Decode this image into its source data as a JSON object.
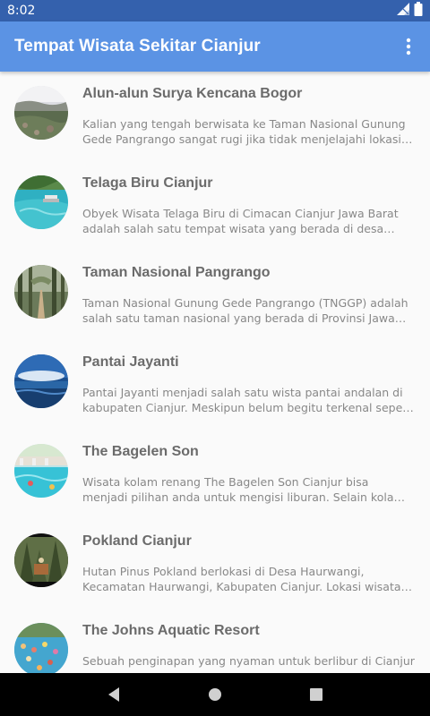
{
  "status_bar": {
    "time": "8:02",
    "icons": [
      "signal-icon",
      "battery-icon"
    ]
  },
  "app_bar": {
    "title": "Tempat Wisata Sekitar Cianjur",
    "menu_icon": "more-vert-icon"
  },
  "colors": {
    "status_bar": "#3461ad",
    "app_bar": "#5b93e4",
    "background": "#fafafa",
    "title_text": "#6b6b6b",
    "desc_text": "#888888",
    "nav_bar": "#000000"
  },
  "items": [
    {
      "title": "Alun-alun Surya Kencana Bogor",
      "description": "Kalian yang tengah berwisata ke Taman Nasional Gunung Gede Pangrango sangat rugi jika tidak menjelajahi lokasi wisata Alun-alun Surya Kencana",
      "image": "mountain-meadow-photo"
    },
    {
      "title": "Telaga Biru Cianjur",
      "description": "Obyek Wisata Telaga Biru di Cimacan  Cianjur Jawa Barat adalah salah satu tempat wisata yang berada di desa cimacan",
      "image": "blue-lake-photo"
    },
    {
      "title": "Taman Nasional Pangrango",
      "description": "Taman Nasional Gunung Gede Pangrango (TNGGP) adalah salah satu taman nasional yang berada di Provinsi Jawa Barat",
      "image": "forest-path-photo"
    },
    {
      "title": "Pantai Jayanti",
      "description": "Pantai Jayanti menjadi salah satu wista pantai andalan di kabupaten Cianjur. Meskipun belum begitu terkenal seperti pantai lain",
      "image": "beach-sky-photo"
    },
    {
      "title": "The Bagelen Son",
      "description": "Wisata kolam renang The Bagelen Son Cianjur bisa menjadi pilihan anda untuk mengisi liburan. Selain kolam renang",
      "image": "swimming-pool-photo"
    },
    {
      "title": "Pokland Cianjur",
      "description": "Hutan Pinus Pokland berlokasi di Desa Haurwangi, Kecamatan Haurwangi, Kabupaten Cianjur. Lokasi wisata ini",
      "image": "pine-forest-photo"
    },
    {
      "title": "The Johns Aquatic Resort",
      "description": "Sebuah penginapan yang nyaman untuk berlibur di Cianjur",
      "image": "water-park-photo"
    }
  ],
  "nav_bar": {
    "buttons": [
      "back-icon",
      "home-icon",
      "recents-icon"
    ]
  }
}
